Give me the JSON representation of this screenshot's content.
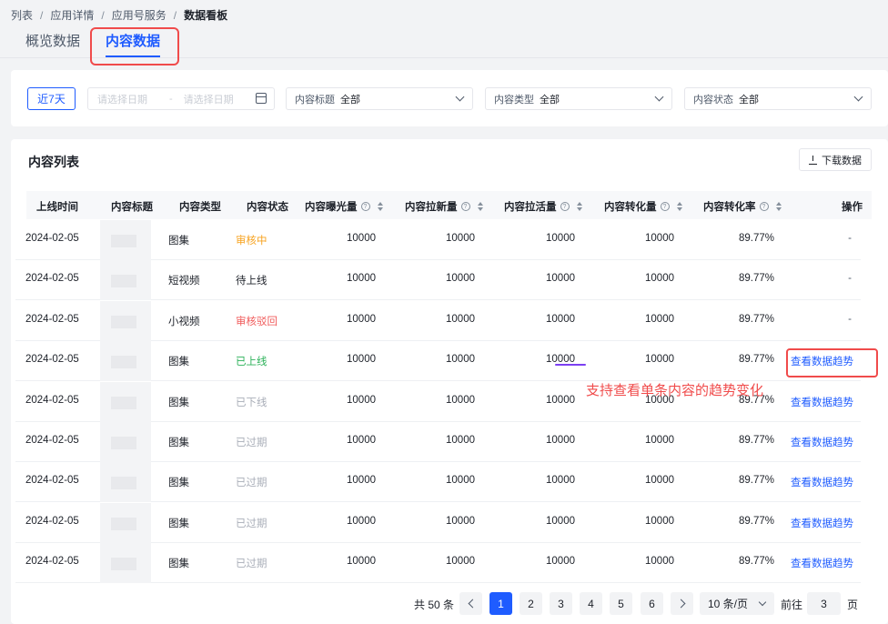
{
  "breadcrumb": [
    "列表",
    "应用详情",
    "应用号服务",
    "数据看板"
  ],
  "tabs": [
    "概览数据",
    "内容数据"
  ],
  "filters": {
    "quick_range": "近7天",
    "date_start_placeholder": "请选择日期",
    "date_sep": "-",
    "date_end_placeholder": "请选择日期",
    "selects": [
      {
        "label": "内容标题",
        "value": "全部"
      },
      {
        "label": "内容类型",
        "value": "全部"
      },
      {
        "label": "内容状态",
        "value": "全部"
      }
    ]
  },
  "list": {
    "title": "内容列表",
    "download_label": "下载数据",
    "columns": [
      "上线时间",
      "内容标题",
      "内容类型",
      "内容状态",
      "内容曝光量",
      "内容拉新量",
      "内容拉活量",
      "内容转化量",
      "内容转化率",
      "操作"
    ],
    "rows": [
      {
        "date": "2024-02-05",
        "type": "图集",
        "status": "审核中",
        "status_color": "orange",
        "v1": "10000",
        "v2": "10000",
        "v3": "10000",
        "v4": "10000",
        "rate": "89.77%",
        "op": "-"
      },
      {
        "date": "2024-02-05",
        "type": "短视频",
        "status": "待上线",
        "status_color": "dark",
        "v1": "10000",
        "v2": "10000",
        "v3": "10000",
        "v4": "10000",
        "rate": "89.77%",
        "op": "-"
      },
      {
        "date": "2024-02-05",
        "type": "小视频",
        "status": "审核驳回",
        "status_color": "red",
        "v1": "10000",
        "v2": "10000",
        "v3": "10000",
        "v4": "10000",
        "rate": "89.77%",
        "op": "-"
      },
      {
        "date": "2024-02-05",
        "type": "图集",
        "status": "已上线",
        "status_color": "green",
        "v1": "10000",
        "v2": "10000",
        "v3": "10000",
        "v4": "10000",
        "rate": "89.77%",
        "op": "查看数据趋势"
      },
      {
        "date": "2024-02-05",
        "type": "图集",
        "status": "已下线",
        "status_color": "gray",
        "v1": "10000",
        "v2": "10000",
        "v3": "10000",
        "v4": "10000",
        "rate": "89.77%",
        "op": "查看数据趋势"
      },
      {
        "date": "2024-02-05",
        "type": "图集",
        "status": "已过期",
        "status_color": "gray",
        "v1": "10000",
        "v2": "10000",
        "v3": "10000",
        "v4": "10000",
        "rate": "89.77%",
        "op": "查看数据趋势"
      },
      {
        "date": "2024-02-05",
        "type": "图集",
        "status": "已过期",
        "status_color": "gray",
        "v1": "10000",
        "v2": "10000",
        "v3": "10000",
        "v4": "10000",
        "rate": "89.77%",
        "op": "查看数据趋势"
      },
      {
        "date": "2024-02-05",
        "type": "图集",
        "status": "已过期",
        "status_color": "gray",
        "v1": "10000",
        "v2": "10000",
        "v3": "10000",
        "v4": "10000",
        "rate": "89.77%",
        "op": "查看数据趋势"
      },
      {
        "date": "2024-02-05",
        "type": "图集",
        "status": "已过期",
        "status_color": "gray",
        "v1": "10000",
        "v2": "10000",
        "v3": "10000",
        "v4": "10000",
        "rate": "89.77%",
        "op": "查看数据趋势"
      }
    ]
  },
  "annotation": "支持查看单条内容的趋势变化",
  "pagination": {
    "total": "共 50 条",
    "pages": [
      "1",
      "2",
      "3",
      "4",
      "5",
      "6"
    ],
    "current": "1",
    "page_size": "10 条/页",
    "goto_label": "前往",
    "goto_value": "3",
    "page_suffix": "页"
  },
  "colors": {
    "primary": "#1f5cff",
    "highlight": "#f04b4b"
  }
}
